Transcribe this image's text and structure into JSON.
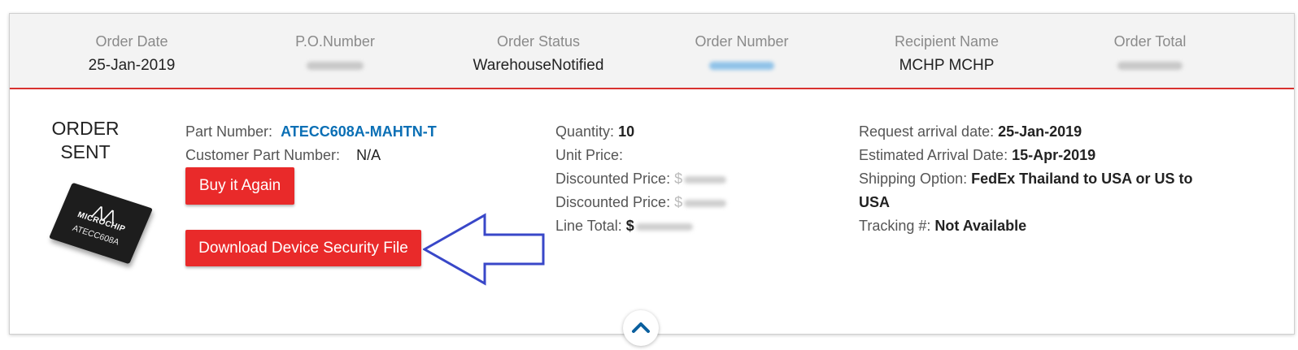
{
  "header": {
    "order_date_label": "Order Date",
    "order_date_value": "25-Jan-2019",
    "po_label": "P.O.Number",
    "status_label": "Order Status",
    "status_value": "WarehouseNotified",
    "order_number_label": "Order Number",
    "recipient_label": "Recipient Name",
    "recipient_value": "MCHP MCHP",
    "total_label": "Order Total"
  },
  "order": {
    "status_line1": "ORDER",
    "status_line2": "SENT",
    "chip_brand": "MICROCHIP",
    "chip_model": "ATECC608A",
    "part_number_label": "Part Number:",
    "part_number_value": "ATECC608A-MAHTN-T",
    "customer_part_label": "Customer Part Number:",
    "customer_part_value": "N/A",
    "buy_again_label": "Buy it Again",
    "download_label": "Download Device Security File"
  },
  "pricing": {
    "quantity_label": "Quantity:",
    "quantity_value": "10",
    "unit_price_label": "Unit Price:",
    "discounted_price_label": "Discounted Price:",
    "discounted_price_2_label": "Discounted Price:",
    "line_total_label": "Line Total:",
    "currency_symbol": "$"
  },
  "shipping": {
    "request_date_label": "Request arrival date:",
    "request_date_value": "25-Jan-2019",
    "estimated_label": "Estimated Arrival Date:",
    "estimated_value": "15-Apr-2019",
    "option_label": "Shipping Option:",
    "option_value_line1": "FedEx Thailand to USA or US to",
    "option_value_line2": "USA",
    "tracking_label": "Tracking #:",
    "tracking_value": "Not Available"
  },
  "icons": {
    "arrow": "left-arrow-outline-icon",
    "toggle": "chevron-up-icon"
  },
  "colors": {
    "accent_red": "#e92a2a",
    "link_blue": "#0a6fb5",
    "arrow_blue": "#3947c8"
  }
}
